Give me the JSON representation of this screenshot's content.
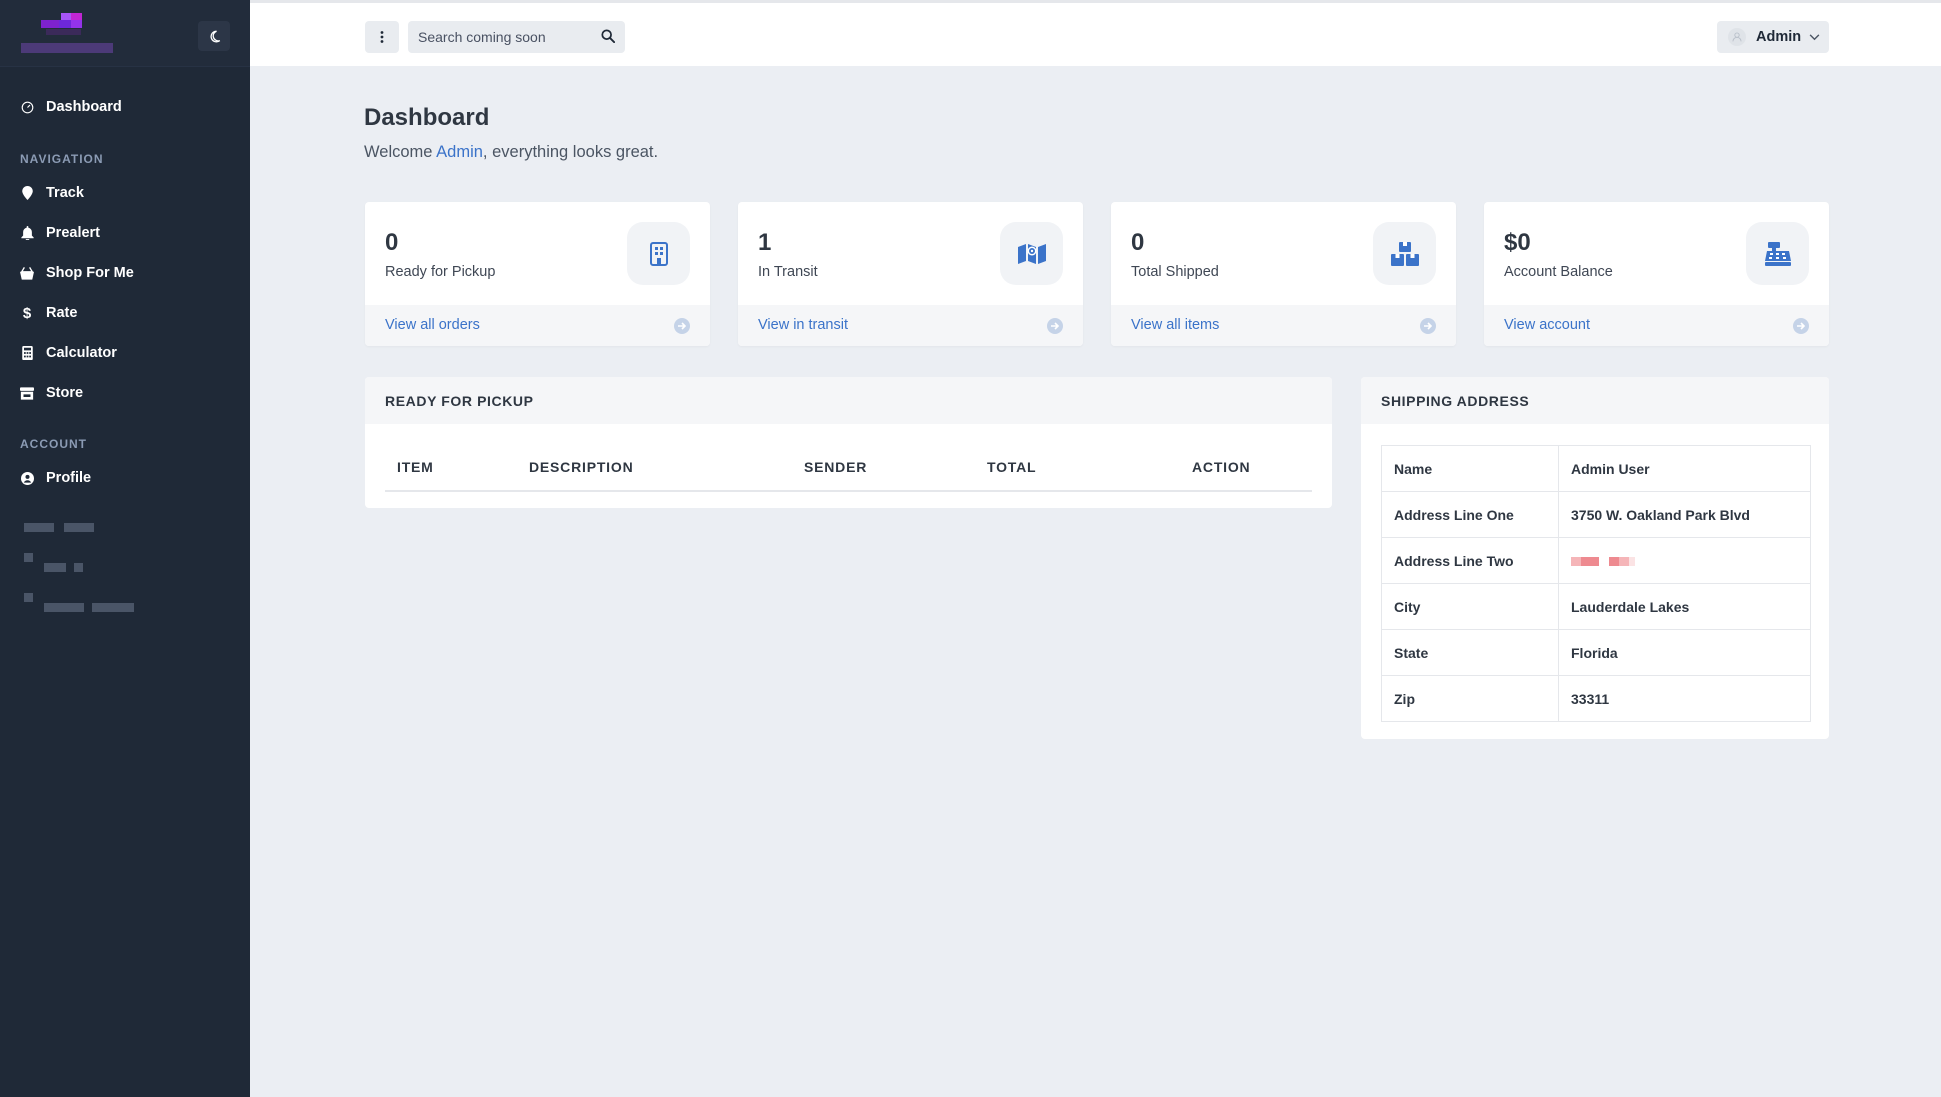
{
  "sidebar": {
    "dashboard_label": "Dashboard",
    "nav_section": "NAVIGATION",
    "nav_items": [
      {
        "label": "Track",
        "icon": "map-pin-icon"
      },
      {
        "label": "Prealert",
        "icon": "bell-icon"
      },
      {
        "label": "Shop For Me",
        "icon": "shopping-basket-icon"
      },
      {
        "label": "Rate",
        "icon": "dollar-icon"
      },
      {
        "label": "Calculator",
        "icon": "calculator-icon"
      },
      {
        "label": "Store",
        "icon": "store-icon"
      }
    ],
    "account_section": "ACCOUNT",
    "profile_label": "Profile"
  },
  "topbar": {
    "search_placeholder": "Search coming soon",
    "user_name": "Admin"
  },
  "page": {
    "title": "Dashboard",
    "welcome_prefix": "Welcome ",
    "welcome_name": "Admin",
    "welcome_suffix": ", everything looks great."
  },
  "cards": [
    {
      "value": "0",
      "label": "Ready for Pickup",
      "link": "View all orders",
      "icon": "building-icon"
    },
    {
      "value": "1",
      "label": "In Transit",
      "link": "View in transit",
      "icon": "map-icon"
    },
    {
      "value": "0",
      "label": "Total Shipped",
      "link": "View all items",
      "icon": "boxes-icon"
    },
    {
      "value": "$0",
      "label": "Account Balance",
      "link": "View account",
      "icon": "cash-register-icon"
    }
  ],
  "pickup_panel": {
    "title": "READY FOR PICKUP",
    "columns": [
      "ITEM",
      "DESCRIPTION",
      "SENDER",
      "TOTAL",
      "ACTION"
    ]
  },
  "address_panel": {
    "title": "SHIPPING ADDRESS",
    "rows": [
      {
        "key": "Name",
        "value": "Admin User"
      },
      {
        "key": "Address Line One",
        "value": "3750 W. Oakland Park Blvd"
      },
      {
        "key": "Address Line Two",
        "value": ""
      },
      {
        "key": "City",
        "value": "Lauderdale Lakes"
      },
      {
        "key": "State",
        "value": "Florida"
      },
      {
        "key": "Zip",
        "value": "33311"
      }
    ]
  },
  "colors": {
    "sidebar_bg": "#1f2937",
    "accent": "#3b73c9",
    "page_bg": "#ebeef3"
  }
}
